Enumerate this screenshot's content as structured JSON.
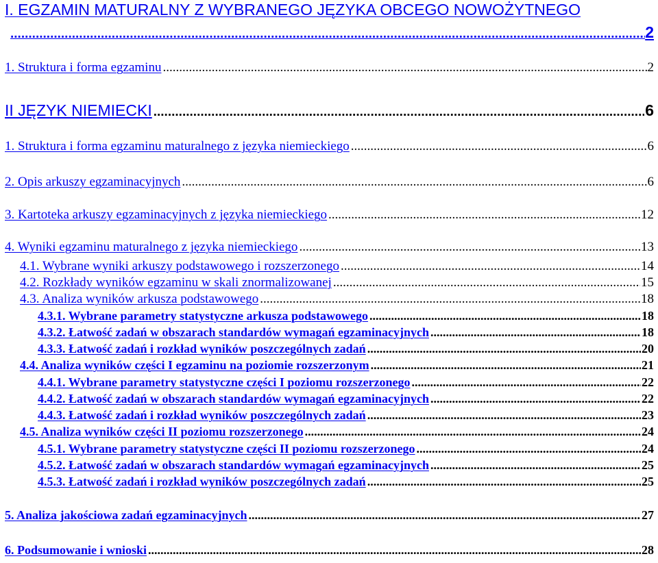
{
  "toc": {
    "entries": [
      {
        "title": "I. EGZAMIN MATURALNY Z WYBRANEGO JĘZYKA OBCEGO NOWOŻYTNEGO",
        "page": "2"
      },
      {
        "title": "1. Struktura i forma egzaminu",
        "page": "2"
      },
      {
        "title": "II JĘZYK NIEMIECKI",
        "page": "6"
      },
      {
        "title": "1. Struktura i forma egzaminu maturalnego z języka niemieckiego",
        "page": "6"
      },
      {
        "title": "2. Opis arkuszy egzaminacyjnych",
        "page": "6"
      },
      {
        "title": "3. Kartoteka arkuszy egzaminacyjnych z języka niemieckiego",
        "page": "12"
      },
      {
        "title": "4. Wyniki egzaminu maturalnego z języka niemieckiego",
        "page": "13"
      },
      {
        "title": "4.1. Wybrane wyniki arkuszy podstawowego i rozszerzonego",
        "page": "14"
      },
      {
        "title": "4.2. Rozkłady wyników egzaminu w skali znormalizowanej",
        "page": "15"
      },
      {
        "title": "4.3. Analiza wyników arkusza podstawowego",
        "page": "18"
      },
      {
        "title": "4.3.1. Wybrane parametry statystyczne arkusza podstawowego",
        "page": "18"
      },
      {
        "title": "4.3.2. Łatwość zadań w obszarach standardów wymagań egzaminacyjnych",
        "page": "18"
      },
      {
        "title": "4.3.3. Łatwość zadań i rozkład wyników poszczególnych zadań",
        "page": "20"
      },
      {
        "title": "4.4. Analiza wyników części I egzaminu na poziomie rozszerzonym",
        "page": "21"
      },
      {
        "title": "4.4.1. Wybrane parametry statystyczne części I poziomu rozszerzonego",
        "page": "22"
      },
      {
        "title": "4.4.2. Łatwość zadań w obszarach standardów wymagań egzaminacyjnych",
        "page": "22"
      },
      {
        "title": "4.4.3. Łatwość zadań i rozkład wyników poszczególnych zadań",
        "page": "23"
      },
      {
        "title": "4.5. Analiza wyników części II poziomu rozszerzonego",
        "page": "24"
      },
      {
        "title": "4.5.1. Wybrane parametry statystyczne części II poziomu rozszerzonego",
        "page": "24"
      },
      {
        "title": "4.5.2. Łatwość zadań w obszarach standardów wymagań egzaminacyjnych",
        "page": "25"
      },
      {
        "title": "4.5.3. Łatwość zadań i rozkład wyników poszczególnych zadań",
        "page": "25"
      },
      {
        "title": "5. Analiza jakościowa zadań egzaminacyjnych",
        "page": "27"
      },
      {
        "title": "6. Podsumowanie i wnioski",
        "page": "28"
      }
    ]
  }
}
